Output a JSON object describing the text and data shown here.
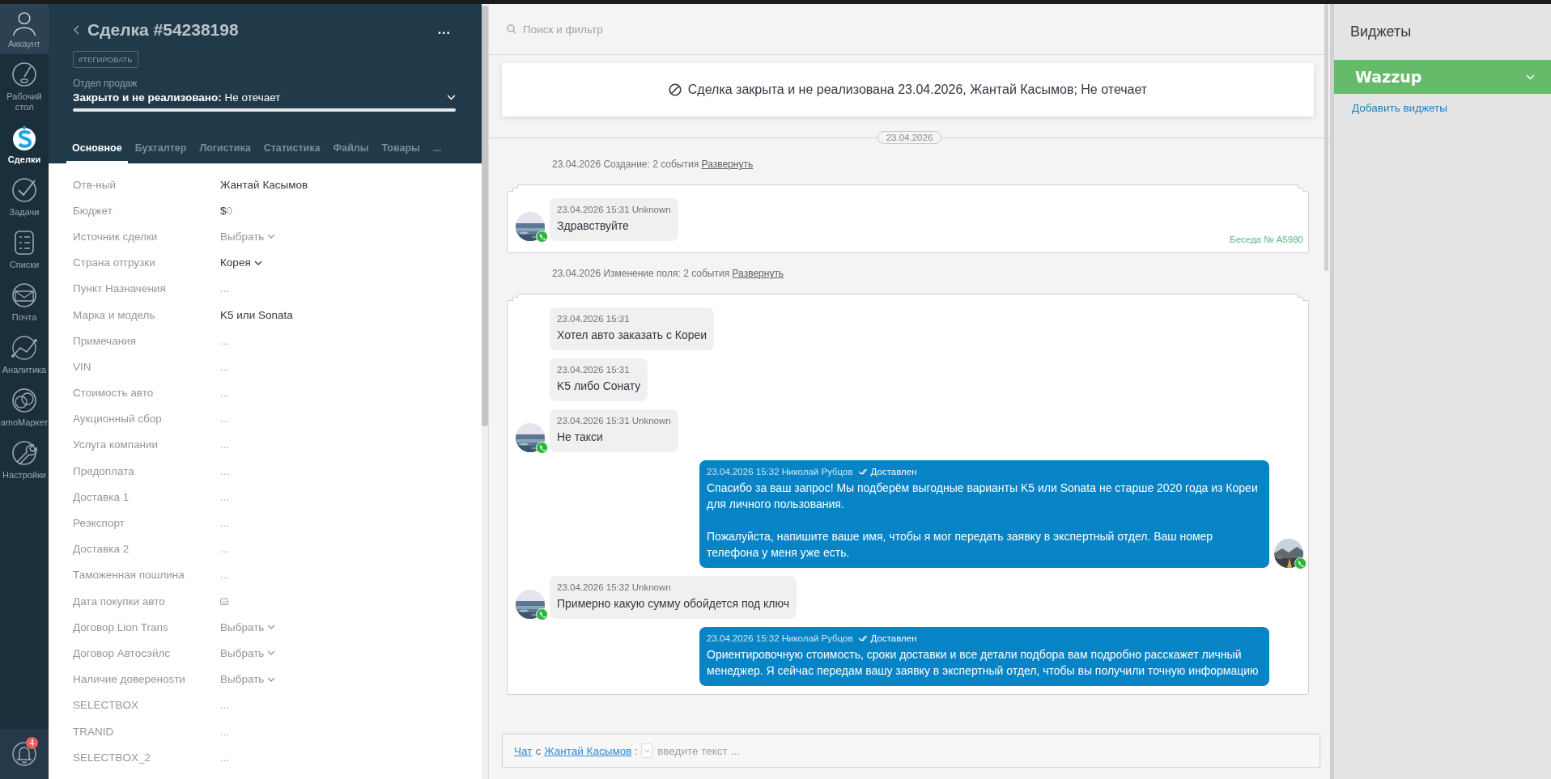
{
  "nav": {
    "items": [
      {
        "label": "Аккаунт",
        "selected": false
      },
      {
        "label": "Рабочий стол",
        "selected": false
      },
      {
        "label": "Сделки",
        "selected": true
      },
      {
        "label": "Задачи",
        "selected": false
      },
      {
        "label": "Списки",
        "selected": false
      },
      {
        "label": "Почта",
        "selected": false
      },
      {
        "label": "Аналитика",
        "selected": false
      },
      {
        "label": "amoМаркет",
        "selected": false
      },
      {
        "label": "Настройки",
        "selected": false
      }
    ],
    "notifications_badge": "4"
  },
  "deal": {
    "title": "Сделка #54238198",
    "more": "...",
    "tag_button": "#ТЕГИРОВАТЬ",
    "pipeline": "Отдел продаж",
    "status": "**Закрыто и не реализовано:** Не отечает",
    "tabs": [
      {
        "label": "Основное",
        "selected": true
      },
      {
        "label": "Бухгалтер",
        "selected": false
      },
      {
        "label": "Логистика",
        "selected": false
      },
      {
        "label": "Статистика",
        "selected": false
      },
      {
        "label": "Файлы",
        "selected": false
      },
      {
        "label": "Товары",
        "selected": false
      }
    ],
    "tabs_more": "...",
    "fields": [
      {
        "label": "Отв-ный",
        "kind": "text",
        "value": "Жантай Касымов"
      },
      {
        "label": "Бюджет",
        "kind": "money",
        "currency": "$",
        "value": "0"
      },
      {
        "label": "Источник сделки",
        "kind": "select",
        "placeholder": "Выбрать"
      },
      {
        "label": "Страна отгрузки",
        "kind": "select",
        "value": "Корея"
      },
      {
        "label": "Пункт Назначения",
        "kind": "empty",
        "value": "..."
      },
      {
        "label": "Марка и модель",
        "kind": "text",
        "value": "K5 или Sonata"
      },
      {
        "label": "Примечания",
        "kind": "empty",
        "value": "..."
      },
      {
        "label": "VIN",
        "kind": "empty",
        "value": "..."
      },
      {
        "label": "Стоимость авто",
        "kind": "empty",
        "value": "..."
      },
      {
        "label": "Аукционный сбор",
        "kind": "empty",
        "value": "..."
      },
      {
        "label": "Услуга компании",
        "kind": "empty",
        "value": "..."
      },
      {
        "label": "Предоплата",
        "kind": "empty",
        "value": "..."
      },
      {
        "label": "Доставка 1",
        "kind": "empty",
        "value": "..."
      },
      {
        "label": "Реэкспорт",
        "kind": "empty",
        "value": "..."
      },
      {
        "label": "Доставка 2",
        "kind": "empty",
        "value": "..."
      },
      {
        "label": "Таможенная пошлина",
        "kind": "empty",
        "value": "..."
      },
      {
        "label": "Дата покупки авто",
        "kind": "date"
      },
      {
        "label": "Договор Lion Trans",
        "kind": "select",
        "placeholder": "Выбрать"
      },
      {
        "label": "Договор Автосэйлс",
        "kind": "select",
        "placeholder": "Выбрать"
      },
      {
        "label": "Наличие довереноsти",
        "kind": "select",
        "placeholder": "Выбрать"
      },
      {
        "label": "SELECTBOX",
        "kind": "empty",
        "value": "..."
      },
      {
        "label": "TRANID",
        "kind": "empty",
        "value": "..."
      },
      {
        "label": "SELECTBOX_2",
        "kind": "empty",
        "value": "..."
      }
    ]
  },
  "chat": {
    "search": {
      "placeholder": "Поиск и фильтр"
    },
    "closed_banner": "Сделка закрыта и не реализована 23.04.2026, Жантай Касымов; Не отечает",
    "date_chip": "23.04.2026",
    "groups": [
      {
        "summary": "23.04.2026 Создание: 2 события",
        "expand_link": "Развернуть",
        "footer": "Беседа № A5980",
        "messages": [
          {
            "kind": "incoming",
            "meta": "23.04.2026 15:31 Unknown",
            "text": "Здравствуйте",
            "avatar": true
          }
        ]
      },
      {
        "summary": "23.04.2026 Изменение поля: 2 события",
        "expand_link": "Развернуть",
        "messages": [
          {
            "kind": "incoming",
            "meta": "23.04.2026 15:31",
            "text": "Хотел авто заказать с Кореи",
            "avatar": false
          },
          {
            "kind": "incoming",
            "meta": "23.04.2026 15:31",
            "text": "K5 либо Сонату",
            "avatar": false
          },
          {
            "kind": "incoming",
            "meta": "23.04.2026 15:31 Unknown",
            "text": "Не такси",
            "avatar": true
          },
          {
            "kind": "outgoing",
            "meta": "23.04.2026 15:32 Николай Рубцов",
            "status": "Доставлен",
            "text": "Спасибо за ваш запрос! Мы подберём выгодные варианты K5 или Sonata не старше 2020 года из Кореи для личного пользования.\n\nПожалуйста, напишите ваше имя, чтобы я мог передать заявку в экспертный отдел. Ваш номер телефона у меня уже есть.",
            "avatar": true
          },
          {
            "kind": "incoming",
            "meta": "23.04.2026 15:32 Unknown",
            "text": "Примерно какую сумму обойдется под ключ",
            "avatar": true
          },
          {
            "kind": "outgoing",
            "meta": "23.04.2026 15:32 Николай Рубцов",
            "status": "Доставлен",
            "text": "Ориентировочную стоимость, сроки доставки и все детали подбора вам подробно расскажет личный менеджер. Я сейчас передам вашу заявку в экспертный отдел, чтобы вы получили точную информацию",
            "avatar": false
          }
        ]
      }
    ],
    "composer": {
      "chat_link": "Чат",
      "with": "с",
      "contact_link": "Жантай Касымов",
      "colon": ":",
      "placeholder": "введите текст ..."
    }
  },
  "widgets": {
    "title": "Виджеты",
    "items": [
      {
        "name": "Wazzup"
      }
    ],
    "add_link": "Добавить виджеты"
  }
}
